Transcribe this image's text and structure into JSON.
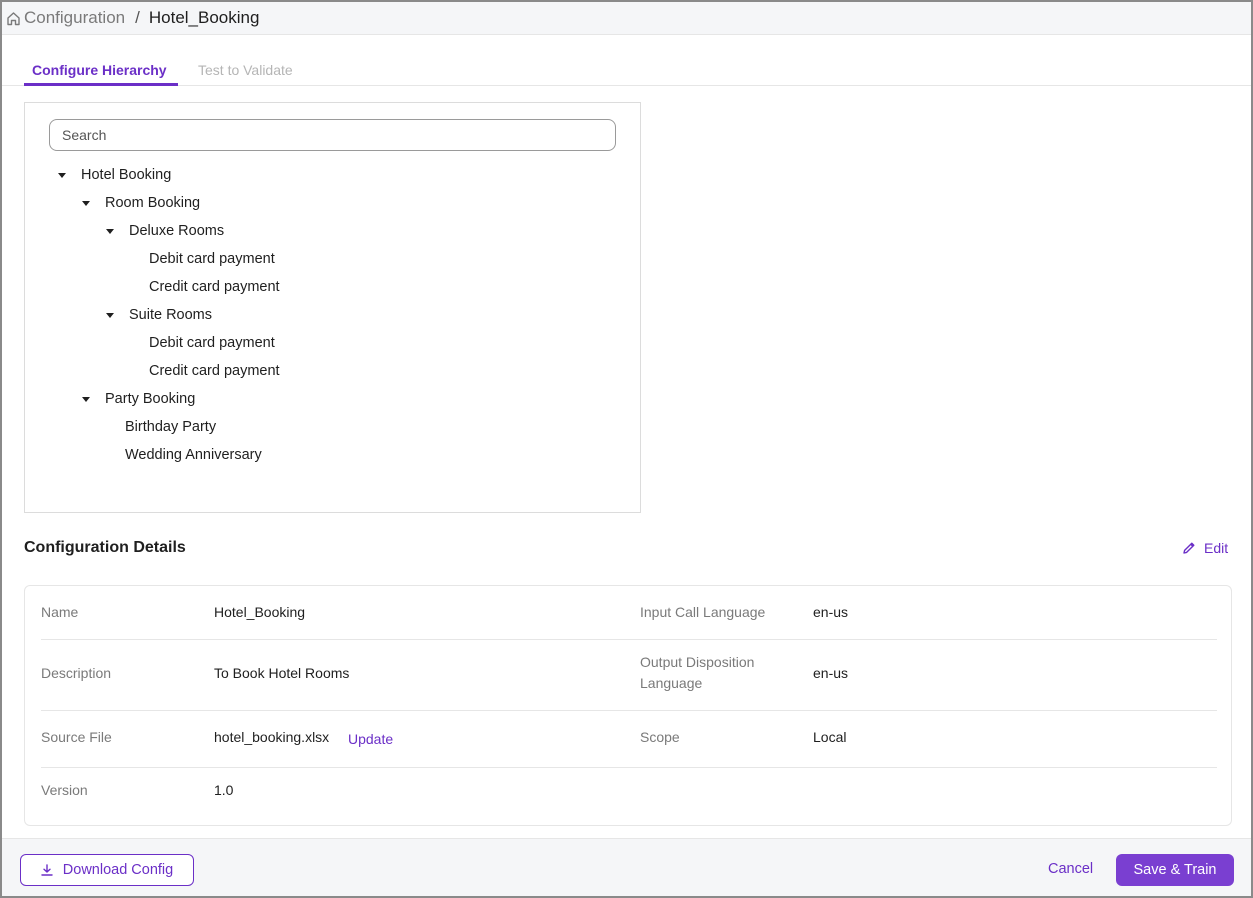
{
  "breadcrumb": {
    "root": "Configuration",
    "separator": "/",
    "current": "Hotel_Booking"
  },
  "tabs": [
    {
      "label": "Configure Hierarchy",
      "active": true
    },
    {
      "label": "Test to Validate",
      "active": false
    }
  ],
  "search": {
    "placeholder": "Search",
    "value": ""
  },
  "tree": {
    "hotel_booking": "Hotel Booking",
    "room_booking": "Room Booking",
    "deluxe_rooms": "Deluxe Rooms",
    "deluxe_debit": "Debit card payment",
    "deluxe_credit": "Credit card payment",
    "suite_rooms": "Suite Rooms",
    "suite_debit": "Debit card payment",
    "suite_credit": "Credit card payment",
    "party_booking": "Party Booking",
    "birthday_party": "Birthday Party",
    "wedding_anniversary": "Wedding Anniversary"
  },
  "details": {
    "title": "Configuration Details",
    "edit_label": "Edit",
    "name_label": "Name",
    "name_value": "Hotel_Booking",
    "input_lang_label": "Input Call Language",
    "input_lang_value": "en-us",
    "description_label": "Description",
    "description_value": "To Book Hotel Rooms",
    "output_lang_label_1": "Output Disposition",
    "output_lang_label_2": "Language",
    "output_lang_value": "en-us",
    "source_label": "Source File",
    "source_value": "hotel_booking.xlsx",
    "update_label": "Update",
    "scope_label": "Scope",
    "scope_value": "Local",
    "version_label": "Version",
    "version_value": "1.0"
  },
  "footer": {
    "download_label": "Download Config",
    "cancel_label": "Cancel",
    "save_label": "Save & Train"
  },
  "colors": {
    "accent": "#6b2fc7",
    "primary_button": "#7a3fd1",
    "muted_text": "#7a7a7a",
    "bar_background": "#f5f6f8"
  },
  "icons": {
    "home": "home-icon",
    "caret": "caret-down-icon",
    "edit": "pencil-icon",
    "download": "download-icon"
  }
}
